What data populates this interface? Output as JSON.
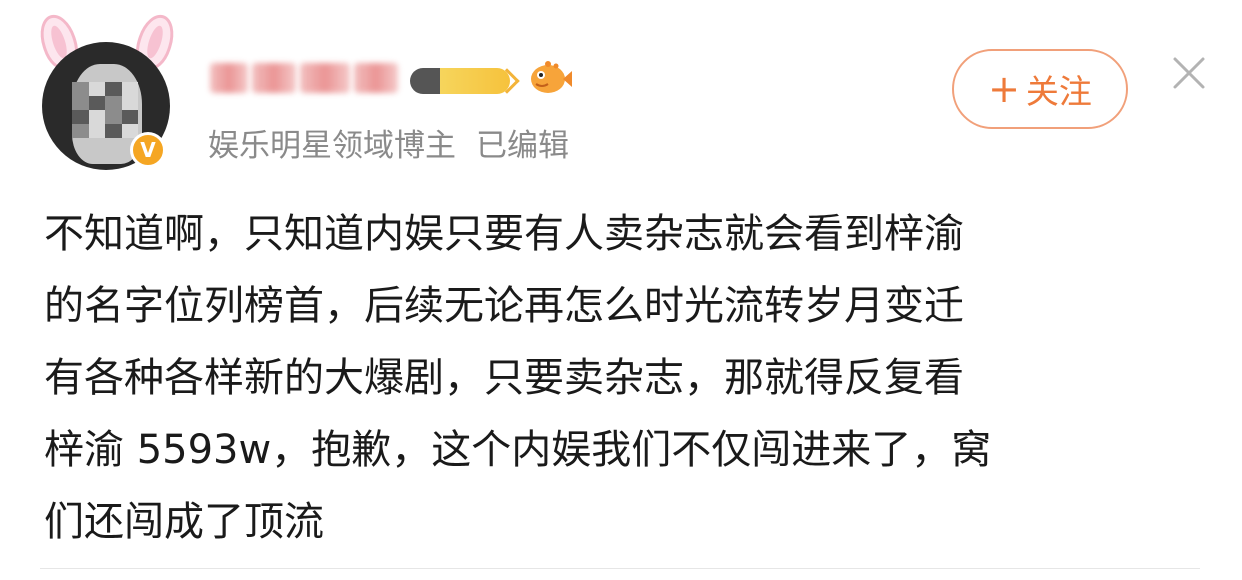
{
  "author": {
    "name_visibility": "obscured",
    "vip_badge": "V",
    "meta_role": "娱乐明星领域博主",
    "meta_status": "已编辑"
  },
  "header": {
    "follow_plus": "+",
    "follow_label": "关注",
    "icons": {
      "level": "user-level-badge-icon",
      "fan": "puffer-fish-icon",
      "close": "close-icon"
    }
  },
  "post": {
    "lines": [
      "不知道啊，只知道内娱只要有人卖杂志就会看到梓渝",
      "的名字位列榜首，后续无论再怎么时光流转岁月变迁",
      "有各种各样新的大爆剧，只要卖杂志，那就得反复看",
      "梓渝 5593w，抱歉，这个内娱我们不仅闯进来了，窝",
      "们还闯成了顶流"
    ]
  },
  "colors": {
    "accent": "#ee7a3a",
    "meta_text": "#8a8a8a",
    "body_text": "#1a1a1a",
    "vip_badge": "#f5a623"
  }
}
